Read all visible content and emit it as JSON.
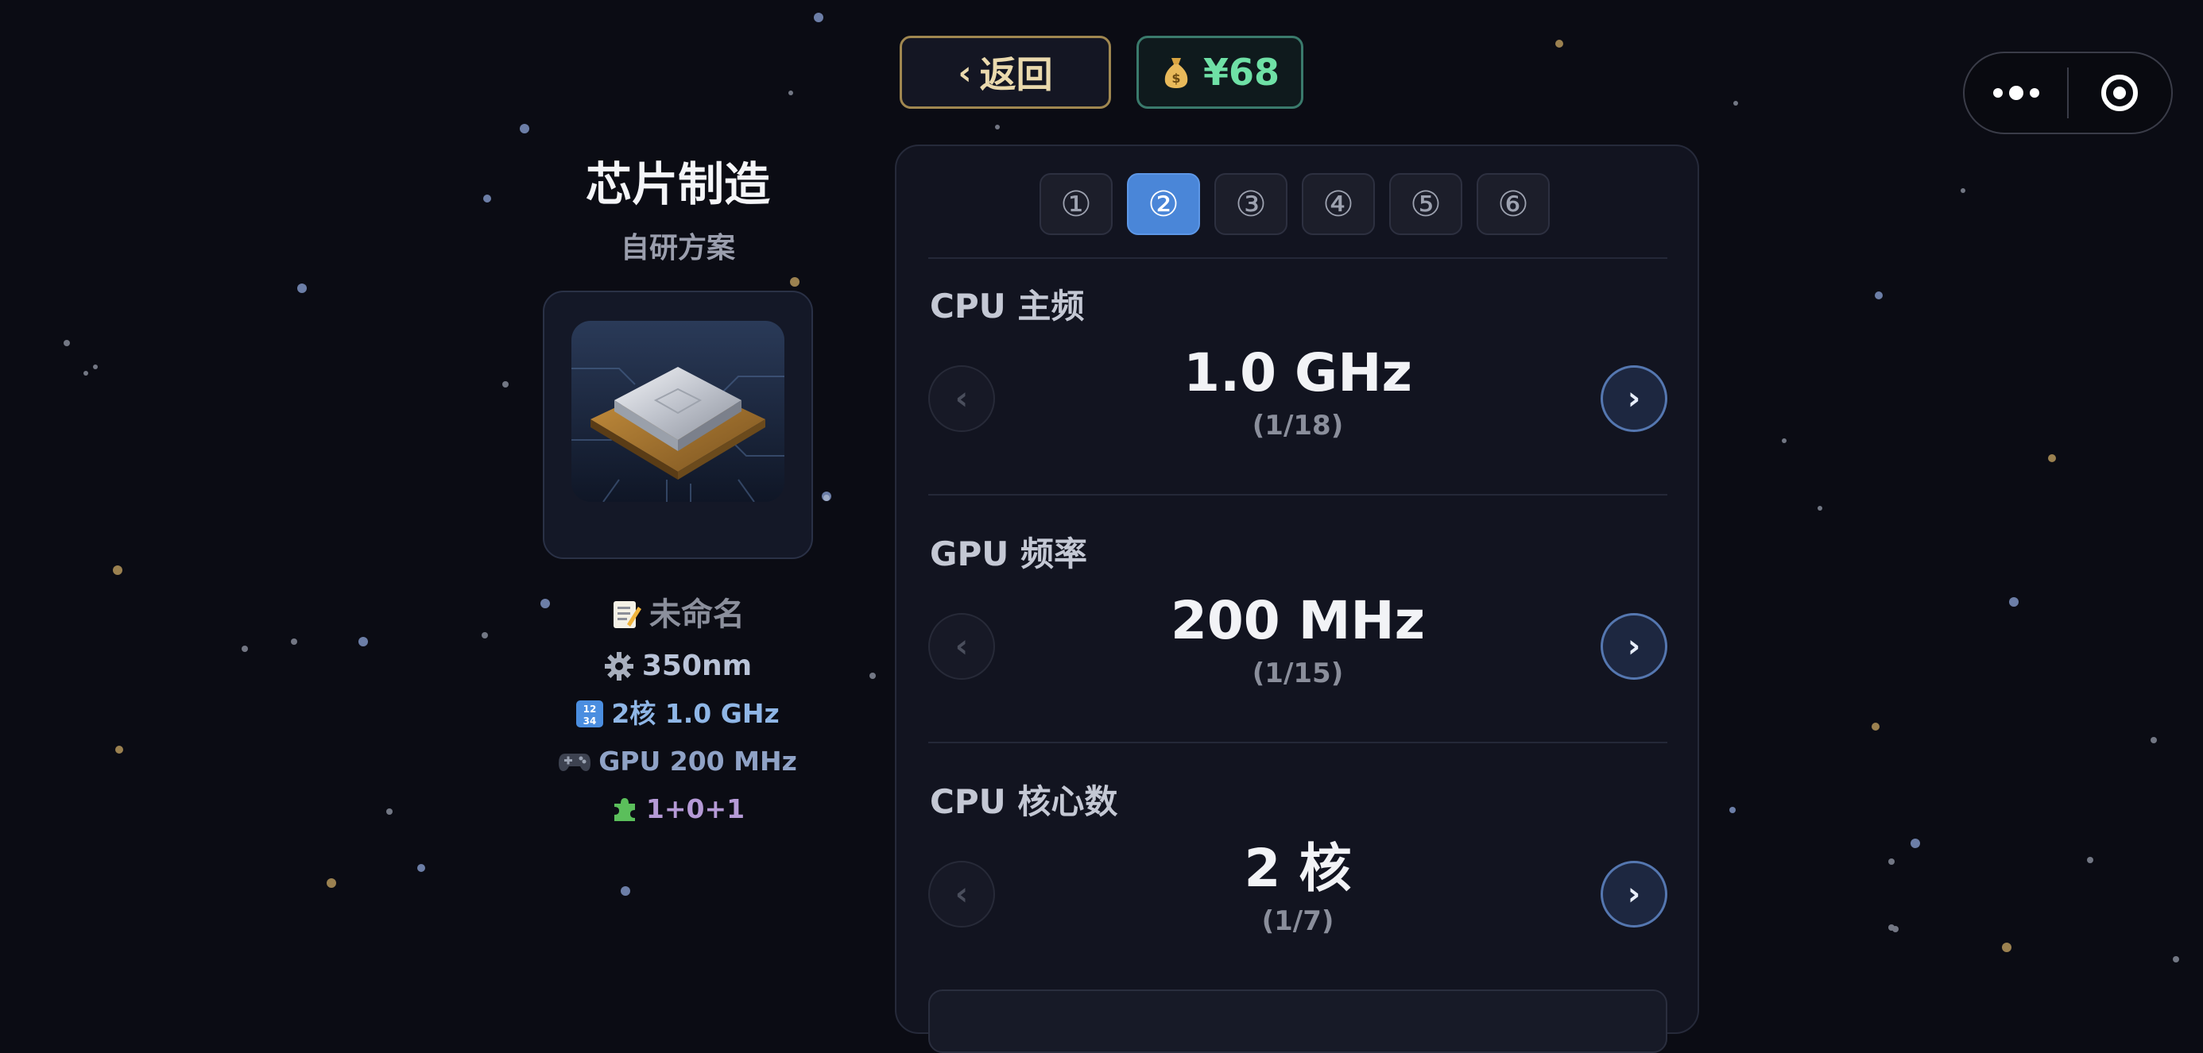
{
  "header": {
    "back_label": "返回",
    "back_icon": "chevron-left-icon",
    "money": "¥68",
    "money_icon": "money-bag-icon"
  },
  "capsule": {
    "more_icon": "more-dots-icon",
    "close_icon": "target-circle-icon"
  },
  "chip": {
    "title": "芯片制造",
    "subtitle": "自研方案",
    "image_icon": "cpu-chip-image",
    "name": "未命名",
    "name_icon": "memo-icon",
    "process": "350nm",
    "process_icon": "gear-icon",
    "cpu_summary": "2核 1.0 GHz",
    "cpu_icon": "numbers-icon",
    "gpu_summary": "GPU 200 MHz",
    "gpu_icon": "gamepad-icon",
    "modules": "1+0+1",
    "modules_icon": "puzzle-icon"
  },
  "steps": [
    {
      "label": "①",
      "active": false
    },
    {
      "label": "②",
      "active": true
    },
    {
      "label": "③",
      "active": false
    },
    {
      "label": "④",
      "active": false
    },
    {
      "label": "⑤",
      "active": false
    },
    {
      "label": "⑥",
      "active": false
    }
  ],
  "params": [
    {
      "label": "CPU 主频",
      "value": "1.0 GHz",
      "index": "(1/18)",
      "prev": "‹",
      "next": "›"
    },
    {
      "label": "GPU 频率",
      "value": "200 MHz",
      "index": "(1/15)",
      "prev": "‹",
      "next": "›"
    },
    {
      "label": "CPU 核心数",
      "value": "2 核",
      "index": "(1/7)",
      "prev": "‹",
      "next": "›"
    }
  ],
  "colors": {
    "background": "#0b0c14",
    "accent_blue": "#4a86d8",
    "gold": "#ead9ad",
    "money_green": "#6fe0a6"
  }
}
